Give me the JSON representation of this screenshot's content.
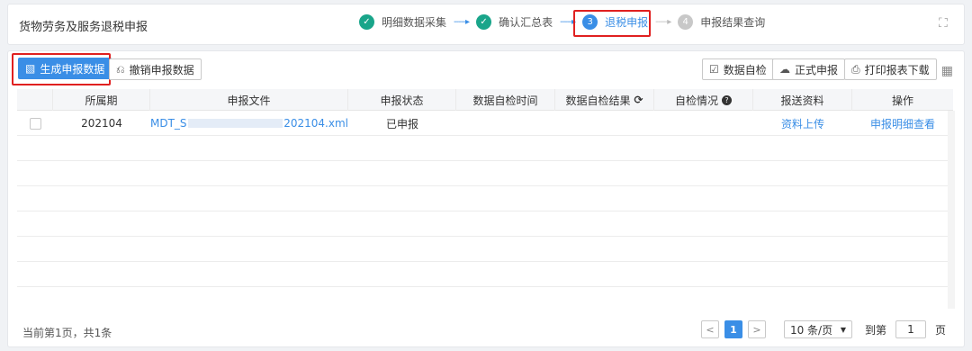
{
  "app": {
    "title": "货物劳务及服务退税申报"
  },
  "steps": [
    {
      "num": "✓",
      "label": "明细数据采集",
      "state": "done"
    },
    {
      "num": "✓",
      "label": "确认汇总表",
      "state": "done"
    },
    {
      "num": "3",
      "label": "退税申报",
      "state": "active"
    },
    {
      "num": "4",
      "label": "申报结果查询",
      "state": "todo"
    }
  ],
  "toolbar": {
    "generate_label": "生成申报数据",
    "revoke_label": "撤销申报数据",
    "selfcheck_label": "数据自检",
    "formal_label": "正式申报",
    "print_label": "打印报表下载"
  },
  "table": {
    "columns": [
      "所属期",
      "申报文件",
      "申报状态",
      "数据自检时间",
      "数据自检结果",
      "自检情况",
      "报送资料",
      "操作"
    ],
    "rows": [
      {
        "period": "202104",
        "file_prefix": "MDT_S",
        "file_suffix": "202104.xml",
        "status": "已申报",
        "check_time": "",
        "check_result": "",
        "check_info": "",
        "material": "资料上传",
        "action": "申报明细查看"
      }
    ]
  },
  "pagination": {
    "summary": "当前第1页，共1条",
    "current": "1",
    "page_size": "10 条/页",
    "jump_prefix": "到第",
    "jump_value": "1",
    "jump_suffix": "页"
  },
  "colors": {
    "accent": "#3a8ee6",
    "done": "#19a58a",
    "highlight": "#e02020"
  }
}
